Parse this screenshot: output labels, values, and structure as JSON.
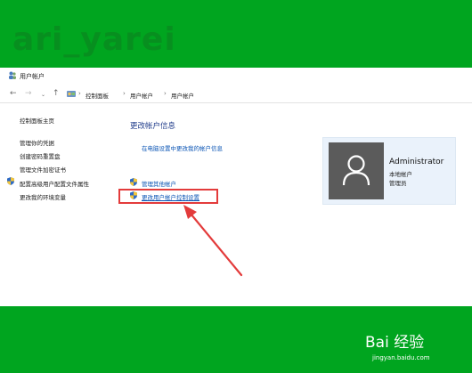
{
  "watermark_top": "ari_yarei",
  "window": {
    "title": "用户帐户",
    "breadcrumbs": [
      "控制面板",
      "用户帐户",
      "用户帐户"
    ]
  },
  "sidebar": {
    "items": [
      {
        "label": "控制面板主页"
      },
      {
        "label": "管理你的凭据"
      },
      {
        "label": "创建密码重置盘"
      },
      {
        "label": "管理文件加密证书"
      },
      {
        "label": "配置高级用户配置文件属性"
      },
      {
        "label": "更改我的环境变量"
      }
    ]
  },
  "main": {
    "title": "更改帐户信息",
    "link_settings": "在电脑设置中更改我的帐户信息",
    "link_manage": "管理其他帐户",
    "link_uac": "更改用户帐户控制设置"
  },
  "user": {
    "name": "Administrator",
    "type": "本地帐户",
    "role": "管理员"
  },
  "watermark_bottom": {
    "brand": "Bai 经验",
    "url": "jingyan.baidu.com"
  },
  "colors": {
    "frame_green": "#00a51f",
    "link_blue": "#0b55b5",
    "highlight_red": "#e33b3b"
  }
}
